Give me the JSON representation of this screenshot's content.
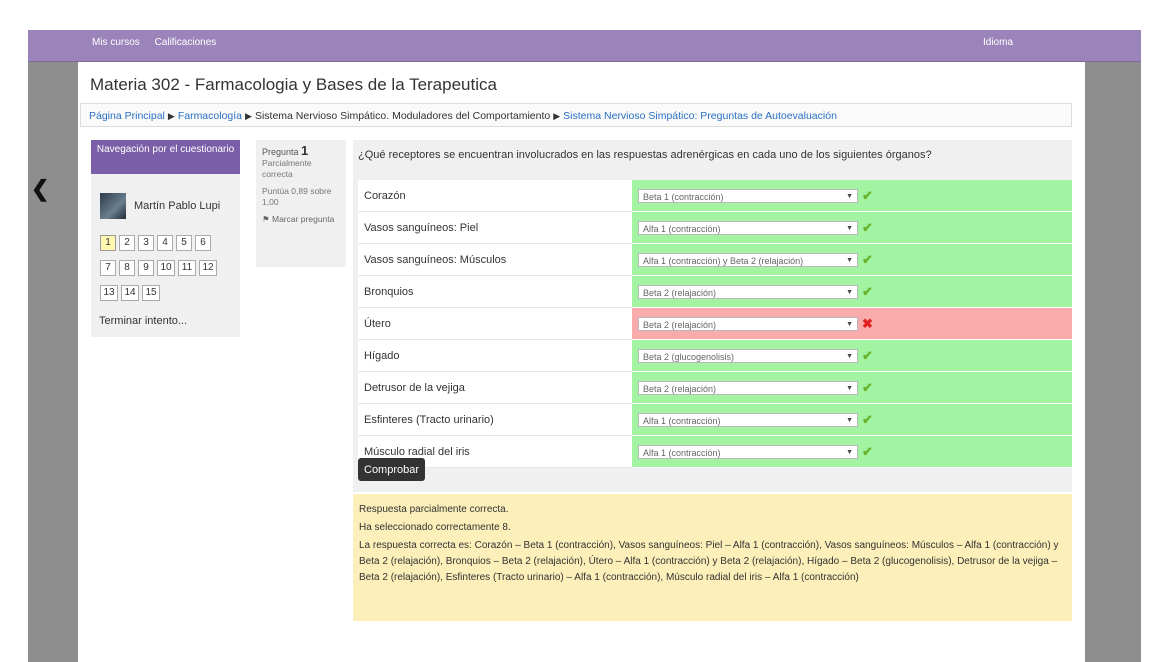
{
  "topnav": {
    "items": [
      "Mis cursos",
      "Calificaciones"
    ],
    "language": "Idioma"
  },
  "page_title": "Materia 302 - Farmacologia y Bases de la Terapeutica",
  "breadcrumb": {
    "items": [
      "Página Principal",
      "Farmacología",
      "Sistema Nervioso Simpático. Moduladores del Comportamiento",
      "Sistema Nervioso Simpático: Preguntas de Autoevaluación"
    ]
  },
  "quiz_nav": {
    "header": "Navegación por el cuestionario",
    "user": "Martín Pablo Lupi",
    "numbers": [
      "1",
      "2",
      "3",
      "4",
      "5",
      "6",
      "7",
      "8",
      "9",
      "10",
      "11",
      "12",
      "13",
      "14",
      "15"
    ],
    "finish": "Terminar intento..."
  },
  "question_info": {
    "label": "Pregunta",
    "number": "1",
    "state": "Parcialmente correcta",
    "score": "Puntúa 0,89 sobre 1,00",
    "flag": "Marcar pregunta"
  },
  "question": {
    "text": "¿Qué receptores se encuentran involucrados en las respuestas adrenérgicas en cada uno de los siguientes órganos?",
    "rows": [
      {
        "organ": "Corazón",
        "answer": "Beta 1 (contracción)",
        "mark": "✔"
      },
      {
        "organ": "Vasos sanguíneos: Piel",
        "answer": "Alfa 1 (contracción)",
        "mark": "✔"
      },
      {
        "organ": "Vasos sanguíneos: Músculos",
        "answer": "Alfa 1 (contracción) y Beta 2 (relajación)",
        "mark": "✔"
      },
      {
        "organ": "Bronquios",
        "answer": "Beta 2 (relajación)",
        "mark": "✔"
      },
      {
        "organ": "Útero",
        "answer": "Beta 2 (relajación)",
        "mark": "✖"
      },
      {
        "organ": "Hígado",
        "answer": "Beta 2 (glucogenolisis)",
        "mark": "✔"
      },
      {
        "organ": "Detrusor de la vejiga",
        "answer": "Beta 2 (relajación)",
        "mark": "✔"
      },
      {
        "organ": "Esfinteres (Tracto urinario)",
        "answer": "Alfa 1 (contracción)",
        "mark": "✔"
      },
      {
        "organ": "Músculo radial del iris",
        "answer": "Alfa 1 (contracción)",
        "mark": "✔"
      }
    ],
    "check_button": "Comprobar"
  },
  "feedback": {
    "line1": "Respuesta parcialmente correcta.",
    "line2": "Ha seleccionado correctamente 8.",
    "line3": "La respuesta correcta es: Corazón – Beta 1 (contracción), Vasos sanguíneos: Piel – Alfa 1 (contracción), Vasos sanguíneos: Músculos – Alfa 1 (contracción) y Beta 2 (relajación), Bronquios – Beta 2 (relajación), Útero – Alfa 1 (contracción) y Beta 2 (relajación), Hígado – Beta 2 (glucogenolisis), Detrusor de la vejiga – Beta 2 (relajación), Esfinteres (Tracto urinario) – Alfa 1 (contracción), Músculo radial del iris – Alfa 1 (contracción)"
  },
  "colors": {
    "topbar": "#9b84ba",
    "nav_header": "#7a5ea7",
    "correct": "#a2f4a2",
    "incorrect": "#f9aaaa",
    "feedback": "#fcefb9"
  }
}
